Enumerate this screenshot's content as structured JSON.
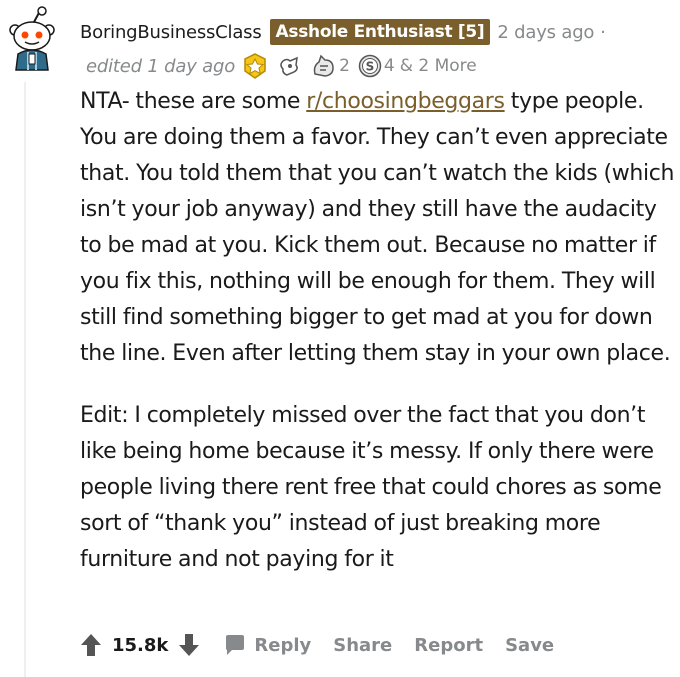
{
  "comment": {
    "username": "BoringBusinessClass",
    "flair": "Asshole Enthusiast [5]",
    "timestamp": "2 days ago",
    "separator": "·",
    "edited": "edited 1 day ago",
    "awards": [
      {
        "name": "gold-award-icon",
        "count": ""
      },
      {
        "name": "wholesome-award-icon",
        "count": ""
      },
      {
        "name": "helpful-award-icon",
        "count": "2"
      },
      {
        "name": "silver-award-icon",
        "count": "4"
      }
    ],
    "more_awards": "& 2 More",
    "body": {
      "p1_before_link": "NTA- these are some ",
      "p1_link": "r/choosingbeggars",
      "p1_after_link": " type people. You are doing them a favor. They can’t even appreciate that. You told them that you can’t watch the kids (which isn’t your job anyway) and they still have the audacity to be mad at you. Kick them out. Because no matter if you fix this, nothing will be enough for them. They will still find something bigger to get mad at you for down the line. Even after letting them stay in your own place.",
      "p2": "Edit: I completely missed over the fact that you don’t like being home because it’s messy. If only there were people living there rent free that could chores as some sort of “thank you” instead of just breaking more furniture and not paying for it"
    },
    "score": "15.8k",
    "actions": {
      "reply": "Reply",
      "share": "Share",
      "report": "Report",
      "save": "Save"
    }
  },
  "colors": {
    "flair_bg": "#7a5f2c",
    "muted": "#878a8c",
    "text": "#1a1a1b",
    "link": "#7a5f2c"
  }
}
